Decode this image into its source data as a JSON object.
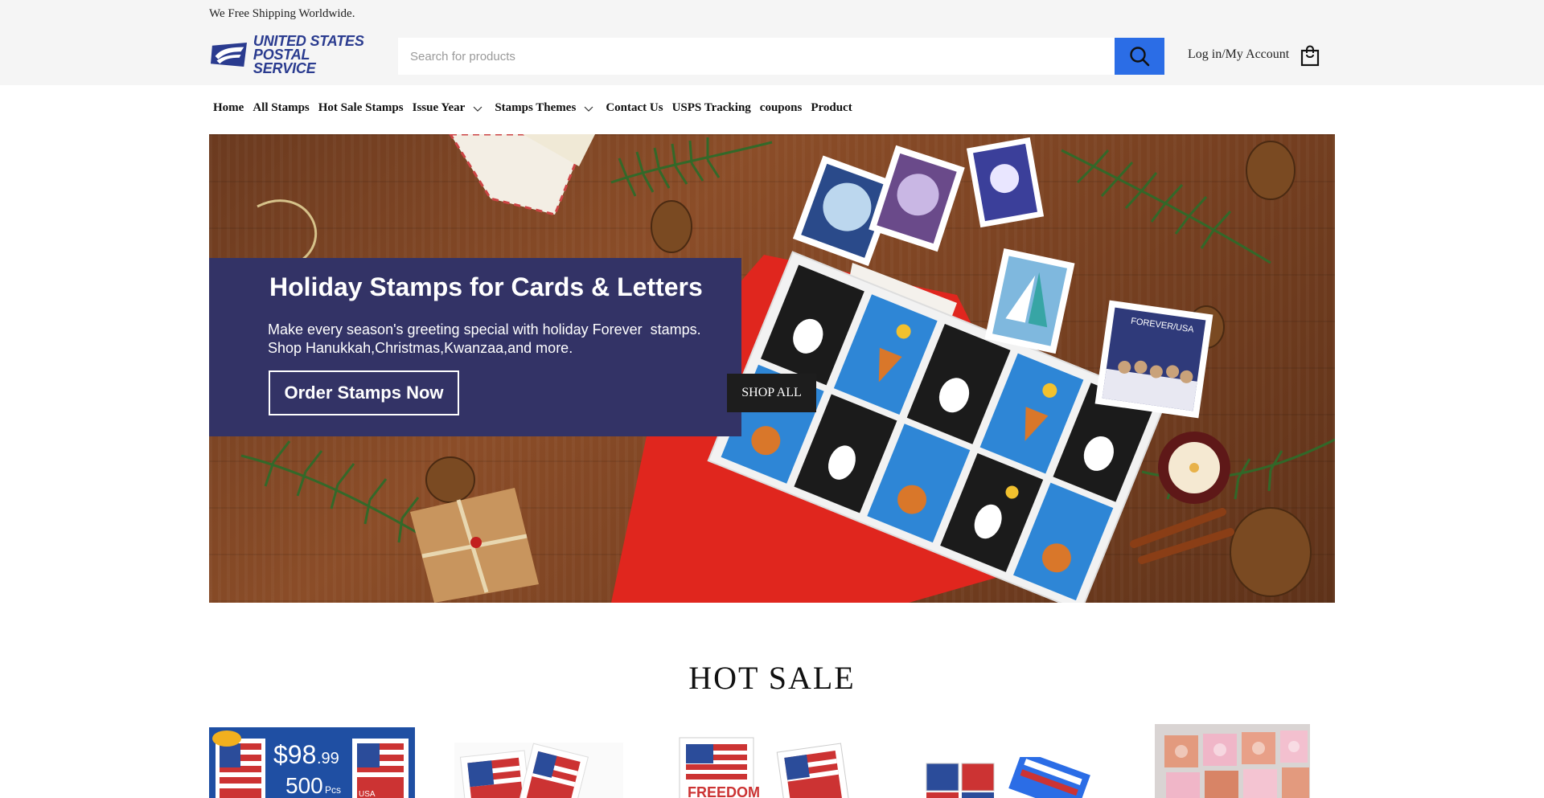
{
  "announcement": "We Free Shipping Worldwide.",
  "logo": {
    "line1": "UNITED STATES",
    "line2": "POSTAL SERVICE"
  },
  "search": {
    "placeholder": "Search for products",
    "button_icon": "search-icon"
  },
  "account": {
    "label": "Log in/My Account"
  },
  "cart": {
    "icon": "shopping-bag-icon"
  },
  "nav": {
    "items": [
      {
        "label": "Home"
      },
      {
        "label": "All Stamps"
      },
      {
        "label": "Hot Sale Stamps"
      },
      {
        "label": "Issue Year",
        "dropdown": true
      },
      {
        "label": "Stamps Themes",
        "dropdown": true
      },
      {
        "label": "Contact Us"
      },
      {
        "label": "USPS Tracking"
      },
      {
        "label": "coupons"
      },
      {
        "label": "Product"
      }
    ]
  },
  "hero": {
    "title": "Holiday Stamps for Cards & Letters",
    "subtitle_line1": "Make every season's greeting special with holiday Forever  stamps.",
    "subtitle_line2": "Shop Hanukkah,Christmas,Kwanzaa,and more.",
    "cta_label": "Order Stamps Now",
    "shop_all_label": "SHOP ALL",
    "stamp_text": "FOREVER/USA"
  },
  "hot_sale": {
    "title": "HOT SALE",
    "badge_price": "$98",
    "badge_cents": ".99",
    "badge_qty": "500",
    "badge_unit": "Pcs",
    "stamp_label": "USA",
    "freedom_label": "FREEDOM"
  },
  "colors": {
    "accent": "#2b6de6",
    "promo_bg": "#333366",
    "brand": "#2a3b8f"
  }
}
